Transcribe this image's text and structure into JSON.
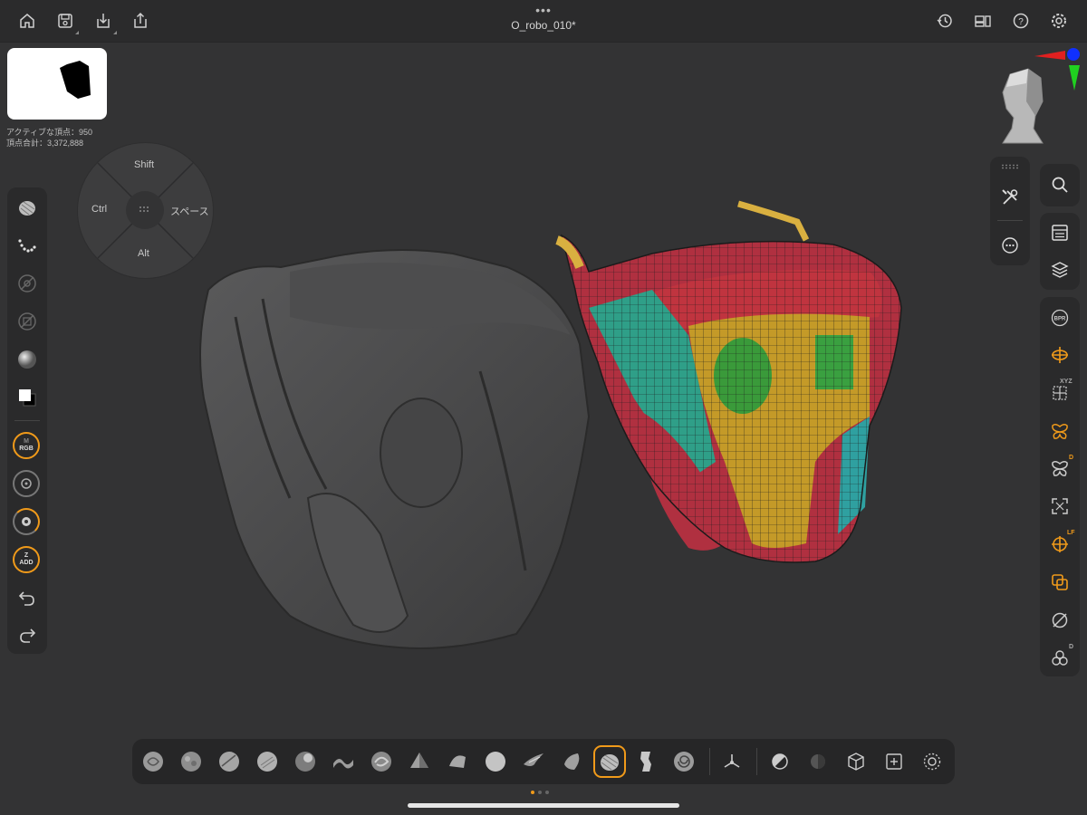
{
  "app": {
    "document_title": "O_robo_010*",
    "more_dots": "•••"
  },
  "topbar": {
    "left_icons": [
      "home-icon",
      "save-icon",
      "download-icon",
      "share-icon"
    ],
    "right_icons": [
      "history-icon",
      "layout-icon",
      "help-icon",
      "settings-icon"
    ]
  },
  "stats": {
    "active_vertices": "アクティブな頂点：950",
    "total_vertices": "頂点合計：3,372,888"
  },
  "modifier_pad": {
    "top": "Shift",
    "left": "Ctrl",
    "right": "スペース",
    "bottom": "Alt"
  },
  "left_toolbar": {
    "rgb_top": "M",
    "rgb_label": "RGB",
    "zadd_top": "Z",
    "zadd_label": "ADD"
  },
  "right_toolbar": {
    "bpr_label": "BPR",
    "xyz_tag": "XYZ",
    "d_tag": "D",
    "lf_tag": "LF",
    "d2_tag": "D"
  },
  "bottom_toolbar": {
    "selected_index": 12,
    "brush_count": 15
  },
  "colors": {
    "accent": "#f09a1a",
    "background": "#333334",
    "panel": "#2a2a2b"
  }
}
